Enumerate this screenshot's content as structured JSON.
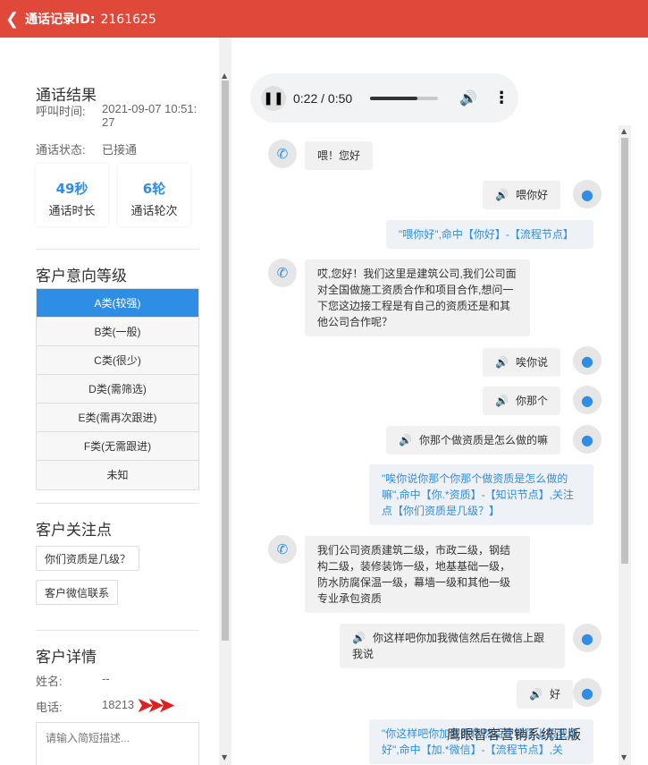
{
  "header": {
    "title": "通话记录ID:",
    "record_id": "2161625"
  },
  "result": {
    "title": "通话结果",
    "call_time_label": "呼叫时间:",
    "call_time_value": "2021-09-07 10:51:27",
    "status_label": "通话状态:",
    "status_value": "已接通",
    "stats": [
      {
        "value": "49秒",
        "label": "通话时长"
      },
      {
        "value": "6轮",
        "label": "通话轮次"
      }
    ]
  },
  "intent": {
    "title": "客户意向等级",
    "levels": [
      "A类(较强)",
      "B类(一般)",
      "C类(很少)",
      "D类(需筛选)",
      "E类(需再次跟进)",
      "F类(无需跟进)",
      "未知"
    ]
  },
  "focus": {
    "title": "客户关注点",
    "tags": [
      "你们资质是几级？",
      "客户微信联系"
    ]
  },
  "details": {
    "title": "客户详情",
    "name_label": "姓名:",
    "name_value": "--",
    "phone_label": "电话:",
    "phone_value": "18213",
    "desc_placeholder": "请输入简短描述..."
  },
  "audio": {
    "current": "0:22",
    "total": "0:50",
    "time_text": "0:22 / 0:50",
    "progress": 0.7
  },
  "chat": {
    "m1": "喂！您好",
    "m2": "喂你好",
    "n1": "\"喂你好\",命中【你好】-【流程节点】",
    "m3": "哎,您好！我们这里是建筑公司,我们公司面对全国做施工资质合作和项目合作,想问一下您这边接工程是有自己的资质还是和其他公司合作呢？",
    "m4": "唉你说",
    "m5": "你那个",
    "m6": "你那个做资质是怎么做的嘛",
    "n2": "\"唉你说你那个你那个做资质是怎么做的嘛\",命中【你.*资质】-【知识节点】,关注点【你们资质是几级？】",
    "m7": "我们公司资质建筑二级，市政二级，钢结构二级，装修装饰一级，地基基础一级，防水防腐保温一级，幕墙一级和其他一级专业承包资质",
    "m8": "你这样吧你加我微信然后在微信上跟我说",
    "m9": "好",
    "n3": "\"你这样吧你加我微信然后在微信上跟我说好\",命中【加.*微信】-【流程节点】,关"
  },
  "watermark": "鹰眼智客营销系统正版",
  "colors": {
    "header": "#e0483a",
    "accent": "#2e8ee6"
  }
}
